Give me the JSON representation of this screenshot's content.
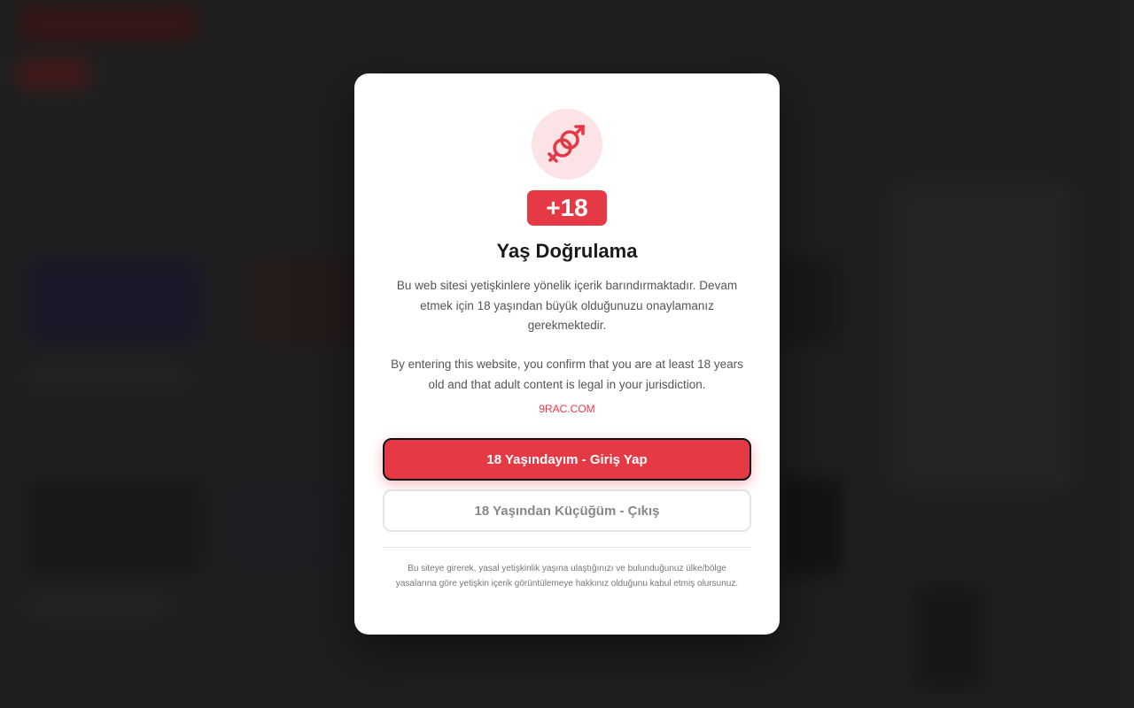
{
  "modal": {
    "badge": "+18",
    "title": "Yaş Doğrulama",
    "description_tr": "Bu web sitesi yetişkinlere yönelik içerik barındırmaktadır. Devam etmek için 18 yaşından büyük olduğunuzu onaylamanız gerekmektedir.",
    "description_en": "By entering this website, you confirm that you are at least 18 years old and that adult content is legal in your jurisdiction.",
    "domain": "9RAC.COM",
    "enter_button": "18 Yaşındayım - Giriş Yap",
    "exit_button": "18 Yaşından Küçüğüm - Çıkış",
    "footnote": "Bu siteye girerek, yasal yetişkinlik yaşına ulaştığınızı ve bulunduğunuz ülke/bölge yasalarına göre yetişkin içerik görüntülemeye hakkınız olduğunu kabul etmiş olursunuz.",
    "icon": "gender-symbols-icon"
  },
  "colors": {
    "accent": "#e63946",
    "icon_bg": "#fbe3e6",
    "page_bg": "#262626"
  }
}
